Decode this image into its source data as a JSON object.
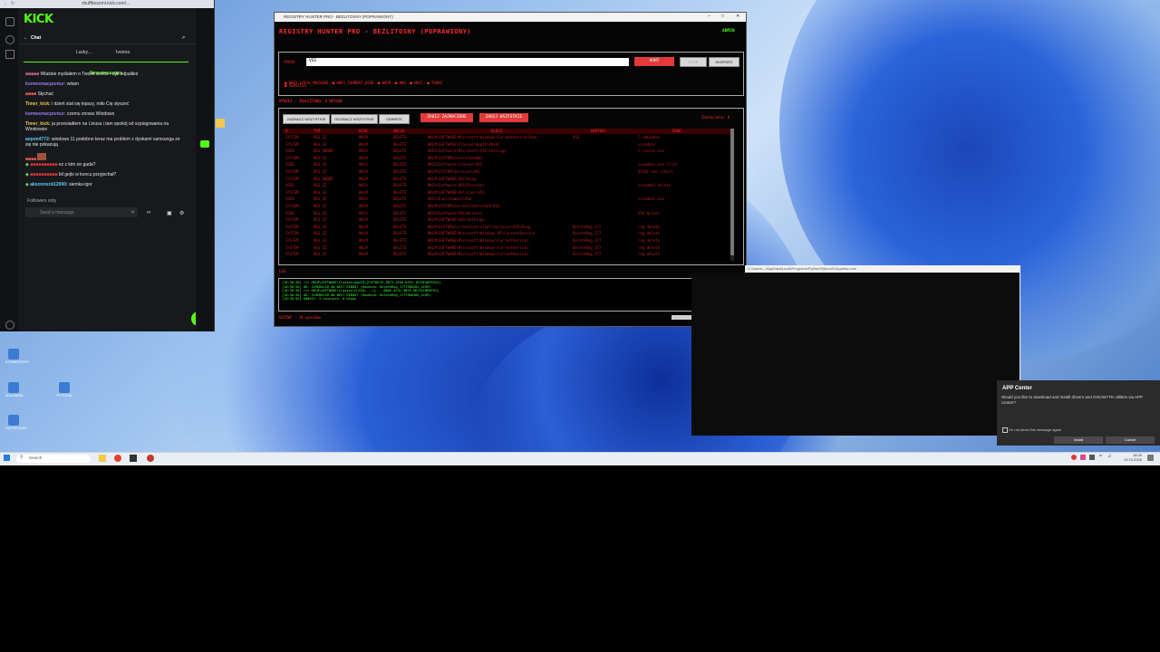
{
  "browser": {
    "url": "zbuffbosomi.kick.com/...",
    "logo": "KICK",
    "chat_title": "Chat",
    "leaders": [
      "Lucky…",
      "Ivonna"
    ],
    "new_messages": "New messages",
    "messages": [
      {
        "user": "",
        "text": "Wlaśnie myślałem o Twoim streće i cyk odpaliłeś",
        "color": "#d46c9b"
      },
      {
        "user": "komwsmacpontur:",
        "text": "witam",
        "color": "#9a7af0"
      },
      {
        "user": "",
        "text": "Słychać",
        "color": "#ff5f5f"
      },
      {
        "user": "Timer_kick:",
        "text": "i dzień stał się lepszy, miło Cię słyszeć",
        "color": "#f2c94c"
      },
      {
        "user": "komwsmacpontur:",
        "text": "czemu znowu Windows",
        "color": "#9a7af0"
      },
      {
        "user": "Timer_kick:",
        "text": "ja przesiadłem na Linuxa i tam spokój od szpiegowania na Windowsie",
        "color": "#f2c94c"
      },
      {
        "user": "axpon4772:",
        "text": "windows 11 podobno teraz ma problem z dyskami samsunga ze się nie pokazują",
        "color": "#5fd0ff"
      },
      {
        "user": "",
        "text": "",
        "color": "#ff5f5f"
      },
      {
        "user": "",
        "text": "ez z kim on gada?",
        "color": "#5fd35f"
      },
      {
        "user": "",
        "text": "bil gejts w koncu przyjechał?",
        "color": "#5fd35f"
      },
      {
        "user": "aksonnxck12000:",
        "text": "siemka igor",
        "color": "#5fd0ff"
      }
    ],
    "followers_only": "Followers only",
    "send_placeholder": "Send a message"
  },
  "registry": {
    "window_title": "REGISTRY HUNTER PRO - BEZLITOSNY (POPRAWIONY)",
    "heading": "REGISTRY HUNTER PRO - BEZLITOSNY (POPRAWIONY)",
    "admin": "ADMIN",
    "fraza_label": "FRAZA:",
    "search_value": "VSS",
    "hunt_label": "HUNT",
    "stop_label": "STOP",
    "export_label": "EKSPORT",
    "checkboxes": [
      "HKEY_LOCAL_MACHINE",
      "HKEY_CURRENT_USER",
      "HKCR",
      "HKU",
      "HKCC",
      "TASKS",
      "SERVICES"
    ],
    "results_label": "WYNIKI - ZNALEZIONO: 0 WPISÓW",
    "buttons": {
      "select_all": "ZAZNACZ WSZYSTKIE",
      "deselect_all": "ODZNACZ WSZYSTKIE",
      "invert": "ODWRÓĆ",
      "kill_selected": "ZABIJ ZAZNACZONE",
      "kill_all": "ZABIJ WSZYSTKIE"
    },
    "selected_count": "Zaznaczono: 0",
    "columns": [
      "#",
      "TYP",
      "HIVE",
      "AKCJA",
      "KLUCZ",
      "WARTOŚĆ",
      "DANE"
    ],
    "rows": [
      [
        "SYSTEM",
        "REG_SZ",
        "HKLM",
        "DELETE",
        "HKLM\\SOFTWARE\\Microsoft\\Windows\\CurrentVersion\\Run",
        "VSS",
        "C:\\Windows"
      ],
      [
        "SYSTEM",
        "REG_SZ",
        "HKLM",
        "DELETE",
        "HKLM\\SOFTWARE\\Classes\\AppID\\VSSVC",
        "",
        "vssadmin"
      ],
      [
        "USER",
        "REG_DWORD",
        "HKCU",
        "DELETE",
        "HKCU\\Software\\Microsoft\\VSS\\Settings",
        "",
        "C:\\vssvc.exe"
      ],
      [
        "SYSTEM",
        "REG_SZ",
        "HKLM",
        "DELETE",
        "HKLM\\SYSTEM\\ControlSet001",
        "",
        ""
      ],
      [
        "USER",
        "REG_SZ",
        "HKCU",
        "DELETE",
        "HKCU\\Software\\Classes\\VSS",
        "",
        "vssadmin.exe /list"
      ],
      [
        "SYSTEM",
        "REG_SZ",
        "HKLM",
        "DELETE",
        "HKLM\\SYSTEM\\Services\\VSS",
        "",
        "VSSVC.exe /start"
      ],
      [
        "SYSTEM",
        "REG_DWORD",
        "HKLM",
        "DELETE",
        "HKLM\\SOFTWARE\\VSS\\Diag",
        "",
        ""
      ],
      [
        "USER",
        "REG_SZ",
        "HKCU",
        "DELETE",
        "HKCU\\Software\\VSS\\Provider",
        "",
        "vssadmin delete"
      ],
      [
        "SYSTEM",
        "REG_SZ",
        "HKLM",
        "DELETE",
        "HKLM\\SOFTWARE\\Policies\\VSS",
        "",
        ""
      ],
      [
        "USER",
        "REG_SZ",
        "HKCU",
        "DELETE",
        "HKCU\\Environment\\VSS",
        "",
        "vssadmin.exe"
      ],
      [
        "SYSTEM",
        "REG_SZ",
        "HKLM",
        "DELETE",
        "HKLM\\SYSTEM\\CurrentControlSet\\VSS",
        "",
        ""
      ],
      [
        "USER",
        "REG_SZ",
        "HKCU",
        "DELETE",
        "HKCU\\Software\\VSS\\Writers",
        "",
        "VSS Writer"
      ],
      [
        "SYSTEM",
        "REG_SZ",
        "HKLM",
        "DELETE",
        "HKLM\\SOFTWARE\\VSS\\Settings",
        "",
        ""
      ],
      [
        "SYSTEM",
        "REG_SZ",
        "HKLM",
        "DELETE",
        "HKLM\\SYSTEM\\CurrentControlSet\\Services\\VSS\\Diag",
        "DeleteReg_177",
        "reg delete"
      ],
      [
        "SYSTEM",
        "REG_SZ",
        "HKLM",
        "DELETE",
        "HKLM\\SOFTWARE\\Microsoft\\Windows NT\\CurrentVersion",
        "DeleteReg_177",
        "reg delete"
      ],
      [
        "SYSTEM",
        "REG_SZ",
        "HKLM",
        "DELETE",
        "HKLM\\SOFTWARE\\Microsoft\\Windows\\CurrentVersion",
        "DeleteReg_177",
        "reg delete"
      ],
      [
        "SYSTEM",
        "REG_SZ",
        "HKLM",
        "DELETE",
        "HKLM\\SOFTWARE\\Microsoft\\Windows\\CurrentVersion",
        "DeleteReg_177",
        "reg delete"
      ],
      [
        "SYSTEM",
        "REG_SZ",
        "HKLM",
        "DELETE",
        "HKLM\\SOFTWARE\\Microsoft\\Windows\\CurrentVersion",
        "DeleteReg_177",
        "reg delete"
      ]
    ],
    "log_label": "LOG",
    "log_lines": [
      "[18:30:50] >>> HKLM\\SOFTWARE\\Classes\\AppID\\{F4FD0C2E-8D73-4E9A-B3F5-1D19FA6E931E}",
      "[18:30:50] OK: SCHEDULED ON NEXT REBOOT (RunOnce: DeleteReg_1777006381_4199)",
      "[18:30:50] >>> HKLM\\SOFTWARE\\Classes\\CLSID\\...\\{...-B8AF-4C9C-9B3F-9D752C8E8F97}",
      "[18:30:50] OK: SCHEDULED ON NEXT REBOOT (RunOnce: DeleteReg_1777006382_4199)",
      "[18:30:50] KONIEC: 5 usunięte, 0 błędy"
    ],
    "status": "GOTOWY - 18 wyników"
  },
  "console": {
    "title": "C:\\Users\\...\\AppData\\Local\\Programs\\Python\\Python311\\python.exe"
  },
  "appcenter": {
    "title": "APP Center",
    "message": "Would you like to download and install drivers and GIGABYTE utilities via APP Center?",
    "checkbox": "Do not show this message again.",
    "install": "Install",
    "cancel": "Cancel"
  },
  "desktop_icons": [
    "KONWERTER",
    "MALWARE",
    "PYTHON",
    "AUTOSTART"
  ],
  "taskbar": {
    "search": "Search",
    "time": "18:30",
    "date": "19.10.2026"
  }
}
